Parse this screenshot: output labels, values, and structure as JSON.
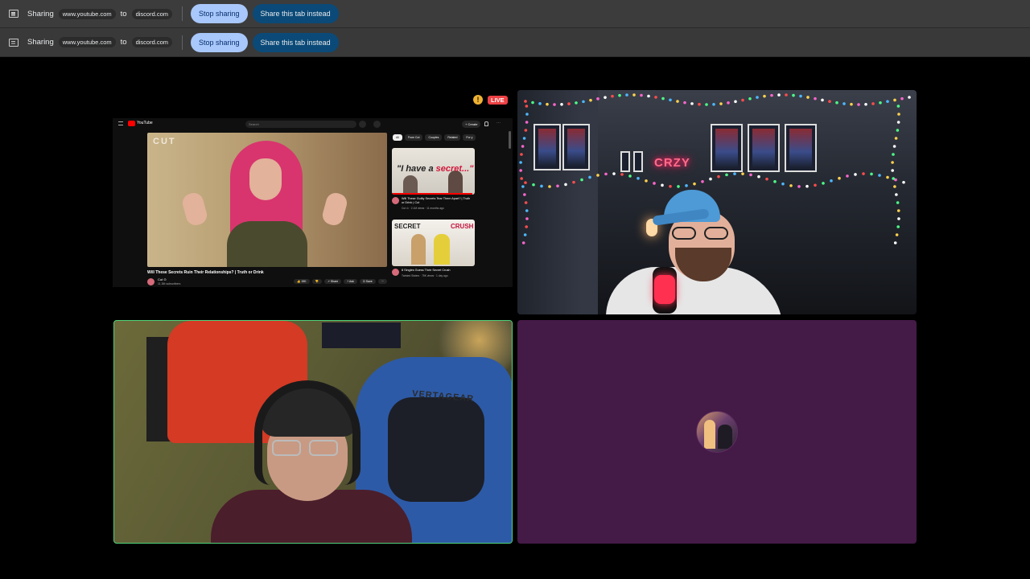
{
  "share_bars": [
    {
      "label": "Sharing",
      "source": "www.youtube.com",
      "to": "to",
      "target": "discord.com",
      "stop_label": "Stop sharing",
      "share_tab_label": "Share this tab instead"
    },
    {
      "label": "Sharing",
      "source": "www.youtube.com",
      "to": "to",
      "target": "discord.com",
      "stop_label": "Stop sharing",
      "share_tab_label": "Share this tab instead"
    }
  ],
  "stream": {
    "warning_icon": "!",
    "live_label": "LIVE"
  },
  "youtube": {
    "logo_text": "YouTube",
    "search_placeholder": "Search",
    "create_label": "+ Create",
    "video_brand": "CUT",
    "video_title": "Will These Secrets Ruin Their Relationships? | Truth or Drink",
    "channel": "Cut ⊙",
    "subscribers": "11.3M subscribers",
    "actions": [
      "👍 19K",
      "👎",
      "↗ Share",
      "+ Ask",
      "⊡ Save",
      "···"
    ],
    "chips": [
      "All",
      "From Cut",
      "Couples",
      "Related",
      "For y"
    ],
    "related": [
      {
        "thumb_text_a": "\"I have a ",
        "thumb_text_b": "secret...\"",
        "title": "Will These Guilty Secrets Tear Them Apart? | Truth or Drink | Cut",
        "meta": "Cut ⊙ · 2.1M views · 11 months ago"
      },
      {
        "thumb_text_a": "SECRET",
        "thumb_text_b": "CRUSH",
        "title": "8 Singles Guess Their Secret Crush",
        "meta": "Twisted Sisters · 75K views · 1 day ago"
      }
    ]
  },
  "cam1": {
    "neon_sign": "CRZY"
  },
  "cam2": {
    "chair_brand": "VERTAGEAR"
  },
  "colors": {
    "share_bar_bg": "#3c3c3c",
    "stop_button": "#a8c7fa",
    "share_button": "#0b4a78",
    "live_badge": "#ed4245",
    "speaking_border": "#4fd27a",
    "avatar_tile_bg": "#441a47"
  }
}
